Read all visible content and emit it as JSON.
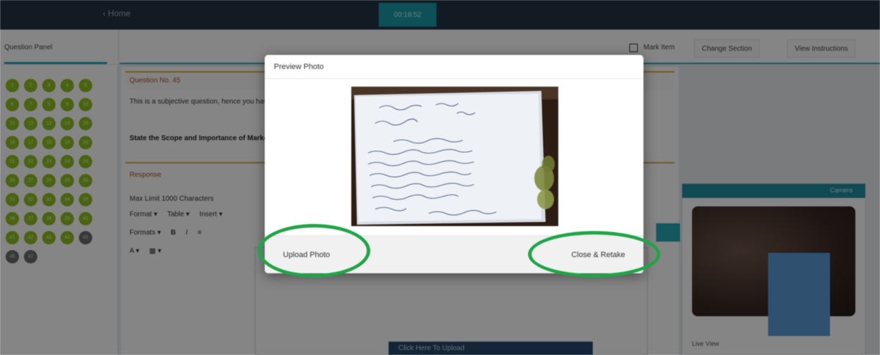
{
  "topbar": {
    "back_label": "‹  Home",
    "timer_label": "00:18:52"
  },
  "subbar": {
    "panel_title": "Question Panel",
    "checkbox_label": "Mark Item",
    "change_section_label": "Change Section",
    "view_instructions_label": "View Instructions"
  },
  "palette": {
    "questions": [
      {
        "num": "1",
        "state": "answered"
      },
      {
        "num": "2",
        "state": "answered"
      },
      {
        "num": "3",
        "state": "answered"
      },
      {
        "num": "4",
        "state": "answered"
      },
      {
        "num": "5",
        "state": "answered"
      },
      {
        "num": "6",
        "state": "answered"
      },
      {
        "num": "7",
        "state": "answered"
      },
      {
        "num": "8",
        "state": "answered"
      },
      {
        "num": "9",
        "state": "answered"
      },
      {
        "num": "10",
        "state": "answered"
      },
      {
        "num": "11",
        "state": "answered"
      },
      {
        "num": "12",
        "state": "answered"
      },
      {
        "num": "13",
        "state": "answered"
      },
      {
        "num": "14",
        "state": "answered"
      },
      {
        "num": "15",
        "state": "answered"
      },
      {
        "num": "16",
        "state": "answered"
      },
      {
        "num": "17",
        "state": "answered"
      },
      {
        "num": "18",
        "state": "answered"
      },
      {
        "num": "19",
        "state": "answered"
      },
      {
        "num": "20",
        "state": "answered"
      },
      {
        "num": "21",
        "state": "answered"
      },
      {
        "num": "22",
        "state": "answered"
      },
      {
        "num": "23",
        "state": "answered"
      },
      {
        "num": "24",
        "state": "answered"
      },
      {
        "num": "25",
        "state": "answered"
      },
      {
        "num": "26",
        "state": "answered"
      },
      {
        "num": "27",
        "state": "answered"
      },
      {
        "num": "28",
        "state": "answered"
      },
      {
        "num": "29",
        "state": "answered"
      },
      {
        "num": "30",
        "state": "answered"
      },
      {
        "num": "31",
        "state": "answered"
      },
      {
        "num": "32",
        "state": "answered"
      },
      {
        "num": "33",
        "state": "answered"
      },
      {
        "num": "34",
        "state": "answered"
      },
      {
        "num": "35",
        "state": "answered"
      },
      {
        "num": "36",
        "state": "answered"
      },
      {
        "num": "37",
        "state": "answered"
      },
      {
        "num": "38",
        "state": "answered"
      },
      {
        "num": "39",
        "state": "answered"
      },
      {
        "num": "40",
        "state": "answered"
      },
      {
        "num": "41",
        "state": "answered"
      },
      {
        "num": "42",
        "state": "answered"
      },
      {
        "num": "43",
        "state": "answered"
      },
      {
        "num": "44",
        "state": "answered"
      },
      {
        "num": "45",
        "state": "current"
      },
      {
        "num": "46",
        "state": "not-visited"
      },
      {
        "num": "47",
        "state": "not-visited"
      }
    ],
    "colors": {
      "answered": "#8fbf20",
      "not_visited": "#6b6b6b"
    }
  },
  "main": {
    "question_no": "Question No. 45",
    "question_text": "This is a subjective question, hence you have to write your answer in the Text-Field given below.",
    "question_bold": "State the Scope and Importance of Marketing.",
    "response_label": "Response",
    "limit_text": "Max Limit 1000 Characters",
    "toolbar_row1": [
      "Format ▾",
      "Table ▾",
      "Insert ▾"
    ],
    "toolbar_row2": [
      "Formats ▾",
      "B",
      "I",
      "≡"
    ],
    "toolbar_row3": [
      "A ▾",
      "▦ ▾"
    ],
    "help_bar": "Click Here To Upload"
  },
  "camera": {
    "head_label": "Camera",
    "foot_label": "Live View"
  },
  "modal": {
    "title": "Preview Photo",
    "upload_label": "Upload Photo",
    "close_label": "Close & Retake"
  },
  "accent": {
    "teal": "#2aa7b7",
    "highlight_ring": "#1fa547",
    "person_box": "#5b9bd5"
  }
}
